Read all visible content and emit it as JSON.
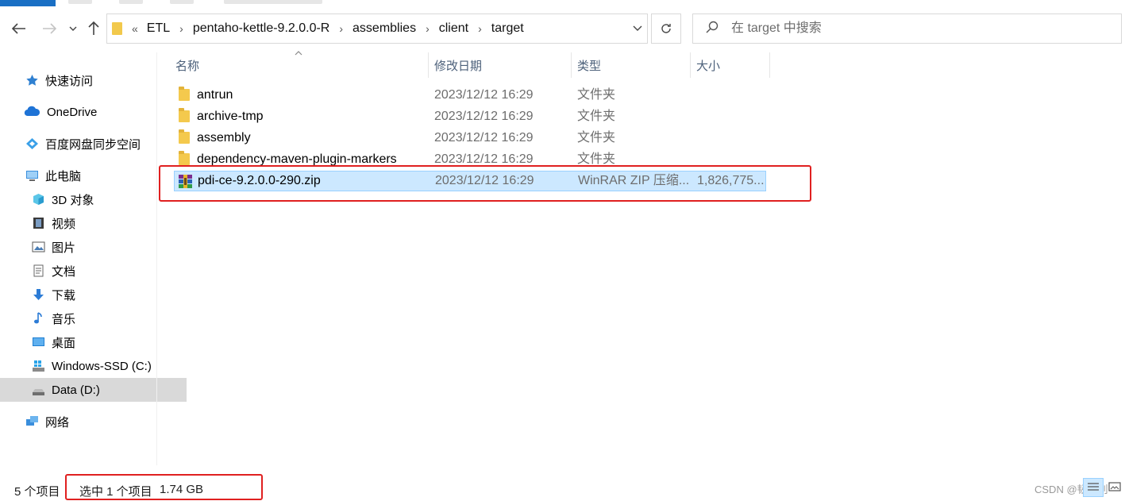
{
  "address": {
    "overflow": "«",
    "crumbs": [
      "ETL",
      "pentaho-kettle-9.2.0.0-R",
      "assemblies",
      "client",
      "target"
    ]
  },
  "search": {
    "placeholder": "在 target 中搜索"
  },
  "sidebar": {
    "items": [
      {
        "label": "快速访问",
        "icon": "star-icon"
      },
      {
        "label": "OneDrive",
        "icon": "cloud-icon"
      },
      {
        "label": "百度网盘同步空间",
        "icon": "baidu-netdisk-icon"
      },
      {
        "label": "此电脑",
        "icon": "computer-icon"
      },
      {
        "label": "3D 对象",
        "icon": "cube-3d-icon"
      },
      {
        "label": "视频",
        "icon": "video-icon"
      },
      {
        "label": "图片",
        "icon": "picture-icon"
      },
      {
        "label": "文档",
        "icon": "document-icon"
      },
      {
        "label": "下载",
        "icon": "download-icon"
      },
      {
        "label": "音乐",
        "icon": "music-icon"
      },
      {
        "label": "桌面",
        "icon": "desktop-icon"
      },
      {
        "label": "Windows-SSD (C:)",
        "icon": "windows-drive-icon"
      },
      {
        "label": "Data (D:)",
        "icon": "drive-icon"
      },
      {
        "label": "网络",
        "icon": "network-icon"
      }
    ]
  },
  "columns": {
    "name": "名称",
    "date": "修改日期",
    "type": "类型",
    "size": "大小"
  },
  "files": [
    {
      "name": "antrun",
      "date": "2023/12/12 16:29",
      "type": "文件夹",
      "size": ""
    },
    {
      "name": "archive-tmp",
      "date": "2023/12/12 16:29",
      "type": "文件夹",
      "size": ""
    },
    {
      "name": "assembly",
      "date": "2023/12/12 16:29",
      "type": "文件夹",
      "size": ""
    },
    {
      "name": "dependency-maven-plugin-markers",
      "date": "2023/12/12 16:29",
      "type": "文件夹",
      "size": ""
    },
    {
      "name": "pdi-ce-9.2.0.0-290.zip",
      "date": "2023/12/12 16:29",
      "type": "WinRAR ZIP 压缩...",
      "size": "1,826,775..."
    }
  ],
  "status": {
    "count": "5 个项目",
    "selected": "选中 1 个项目",
    "selected_size": "1.74 GB"
  },
  "watermark": "CSDN @韧小钊",
  "colors": {
    "selection": "#cce8ff",
    "highlight_box": "#e02020",
    "folder": "#f4c94d"
  }
}
